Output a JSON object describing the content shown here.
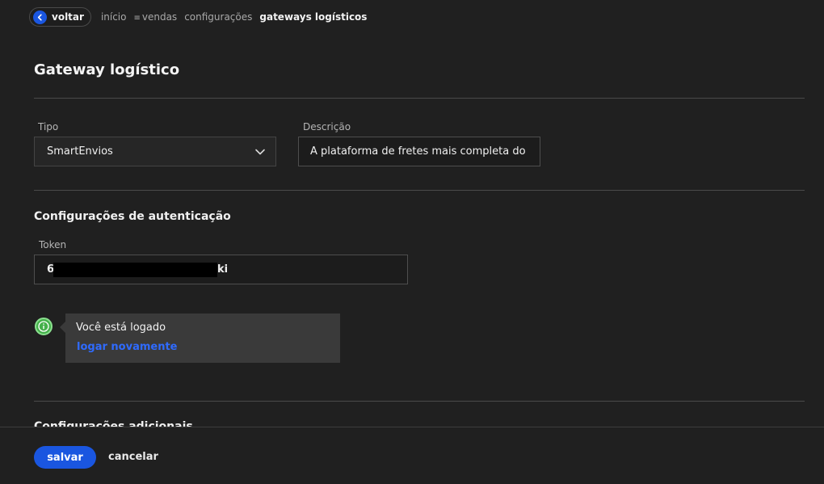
{
  "breadcrumb": {
    "back_label": "voltar",
    "items": [
      {
        "label": "início"
      },
      {
        "label": "vendas",
        "icon": "menu-lines-icon"
      },
      {
        "label": "configurações"
      },
      {
        "label": "gateways logísticos"
      }
    ]
  },
  "page": {
    "title": "Gateway logístico"
  },
  "general": {
    "type_label": "Tipo",
    "type_value": "SmartEnvios",
    "description_label": "Descrição",
    "description_value": "A plataforma de fretes mais completa do"
  },
  "auth": {
    "title": "Configurações de autenticação",
    "token_label": "Token",
    "token_visible_start": "6",
    "token_visible_end": "ki",
    "status_text": "Você está logado",
    "relogin_label": "logar novamente"
  },
  "additional": {
    "title": "Configurações adicionais"
  },
  "footer": {
    "save_label": "salvar",
    "cancel_label": "cancelar"
  },
  "colors": {
    "background": "#202020",
    "accent": "#1a56e0",
    "link": "#2f6bff",
    "success": "#44b04a"
  }
}
